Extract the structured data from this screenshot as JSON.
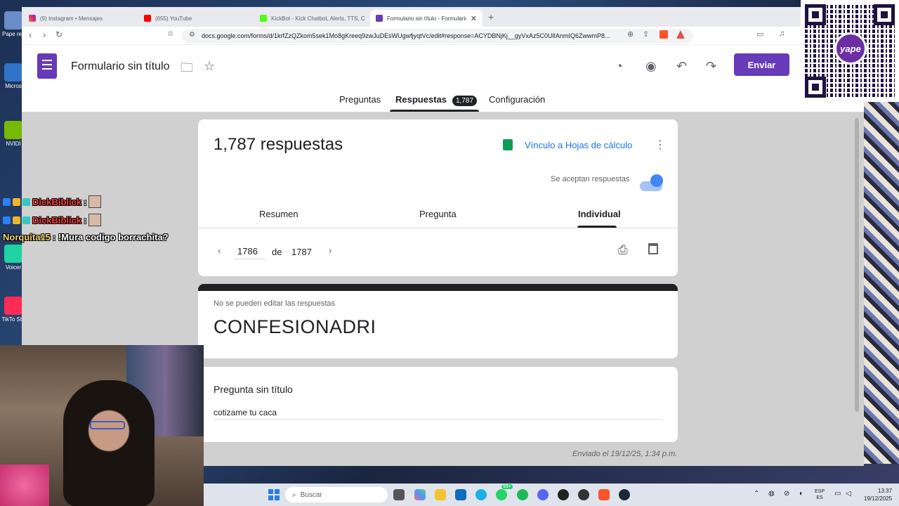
{
  "browser": {
    "tabs": [
      {
        "title": "(9) Instagram • Mensajes"
      },
      {
        "title": "(655) YouTube"
      },
      {
        "title": "KickBot - Kick Chatbot, Alerts, TTS, C"
      },
      {
        "title": "Formulario sin título - Formulario"
      }
    ],
    "url": "docs.google.com/forms/d/1krfZzQZkom5sek1Mo8gKreeq9zwJuDEsWUgwfjyqtVc/edit#response=ACYDBNjKj__gyVxAz5C0UlIAnmIQ6ZwwmP8..."
  },
  "forms": {
    "title": "Formulario sin título",
    "send_label": "Enviar",
    "tabs": {
      "questions": "Preguntas",
      "responses": "Respuestas",
      "responses_count": "1,787",
      "settings": "Configuración"
    }
  },
  "responses": {
    "count_text": "1,787 respuestas",
    "sheets_link": "Vínculo a Hojas de cálculo",
    "accepting_label": "Se aceptan respuestas",
    "accepting": true,
    "subtabs": {
      "summary": "Resumen",
      "question": "Pregunta",
      "individual": "Individual"
    },
    "current_index": "1786",
    "of_label": "de",
    "total": "1787"
  },
  "response": {
    "no_edit_note": "No se pueden editar las respuestas",
    "title": "CONFESIONADRI",
    "question_title": "Pregunta sin título",
    "answer": "cotizame tu caca",
    "submitted": "Enviado el 19/12/25, 1:34 p.m."
  },
  "chat": [
    {
      "user": "DickBiblick",
      "message": ":"
    },
    {
      "user": "DickBiblick",
      "message": ":"
    },
    {
      "user": "Norquita15",
      "message": ": !Mura codigo borrachita?"
    }
  ],
  "qr": {
    "logo_text": "yape"
  },
  "desktop_icons": [
    "Pape rec",
    "Micros",
    "NVIDI",
    "Voicer",
    "TikTo Stu"
  ],
  "taskbar": {
    "search_placeholder": "Buscar",
    "badge": "99+",
    "lang_top": "ESP",
    "lang_bottom": "ES",
    "time": "13:37",
    "date": "19/12/2025"
  },
  "colors": {
    "forms_purple": "#673ab7",
    "link_blue": "#1a73e8",
    "sheets_green": "#0f9d58",
    "toggle_blue": "#4285f4",
    "chat_red": "#ff3b3b",
    "chat_yellow": "#f7d66b"
  },
  "icons": [
    "folder-icon",
    "star-icon",
    "palette-icon",
    "preview-eye-icon",
    "undo-icon",
    "redo-icon",
    "sheets-icon",
    "more-vert-icon",
    "chevron-left-icon",
    "chevron-right-icon",
    "print-icon",
    "delete-icon"
  ]
}
